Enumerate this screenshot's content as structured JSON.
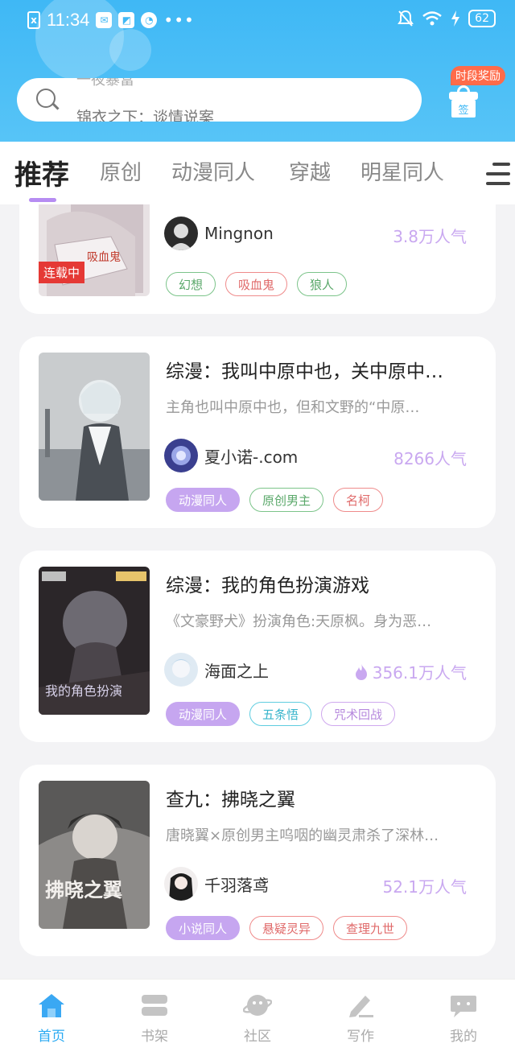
{
  "status_bar": {
    "time": "11:34",
    "battery": "62"
  },
  "search": {
    "previous_hint": "一夜暴富",
    "placeholder": "锦衣之下：谈情说案"
  },
  "reward": {
    "badge": "时段奖励",
    "sign": "签"
  },
  "tabs": [
    {
      "label": "推荐",
      "active": true
    },
    {
      "label": "原创"
    },
    {
      "label": "动漫同人"
    },
    {
      "label": "穿越"
    },
    {
      "label": "明星同人"
    }
  ],
  "books": [
    {
      "author": "Mingnon",
      "popularity": "3.8万人气",
      "status_badge": "连载中",
      "tags": [
        "幻想",
        "吸血鬼",
        "狼人"
      ]
    },
    {
      "title": "综漫：我叫中原中也，关中原中…",
      "description": "主角也叫中原中也，但和文野的“中原…",
      "author": "夏小诺-.com",
      "popularity": "8266人气",
      "tags": [
        "动漫同人",
        "原创男主",
        "名柯"
      ]
    },
    {
      "title": "综漫：我的角色扮演游戏",
      "description": "《文豪野犬》扮演角色:天原枫。身为恶…",
      "author": "海面之上",
      "popularity": "356.1万人气",
      "hot": true,
      "tags": [
        "动漫同人",
        "五条悟",
        "咒术回战"
      ]
    },
    {
      "title": "查九：拂晓之翼",
      "description": "唐晓翼×原创男主呜咽的幽灵肃杀了深林…",
      "author": "千羽落鸢",
      "popularity": "52.1万人气",
      "cover_text": "拂晓之翼",
      "tags": [
        "小说同人",
        "悬疑灵异",
        "查理九世"
      ]
    }
  ],
  "bottom_nav": [
    {
      "label": "首页",
      "icon": "home-icon",
      "active": true
    },
    {
      "label": "书架",
      "icon": "bookshelf-icon"
    },
    {
      "label": "社区",
      "icon": "community-icon"
    },
    {
      "label": "写作",
      "icon": "write-icon"
    },
    {
      "label": "我的",
      "icon": "profile-icon"
    }
  ],
  "colors": {
    "header": "#3fb8f5",
    "accent": "#b68cf2",
    "nav_active": "#2aaaf2",
    "popularity": "#c9a8f0"
  }
}
